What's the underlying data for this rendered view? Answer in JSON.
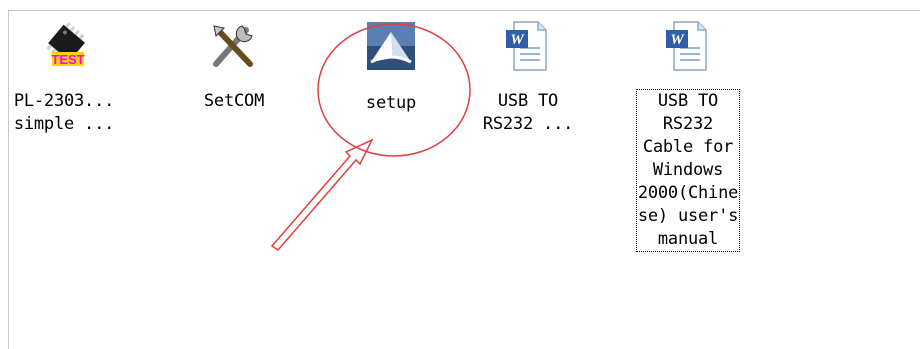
{
  "window": {
    "background": "#ffffff"
  },
  "files": [
    {
      "label": "PL-2303...\nsimple ...",
      "icon": "chip-test-icon"
    },
    {
      "label": "SetCOM",
      "icon": "tools-icon"
    },
    {
      "label": "setup",
      "icon": "installer-icon"
    },
    {
      "label": "USB TO\nRS232 ...",
      "icon": "word-document-icon"
    },
    {
      "label": "USB TO\nRS232\nCable for\nWindows\n2000(Chine\nse) user's\nmanual",
      "icon": "word-document-icon",
      "selected": true
    }
  ],
  "icon_text": {
    "chip_label": "TEST"
  },
  "annotation": {
    "color": "#e04040",
    "shapes": [
      "circle",
      "arrow"
    ]
  }
}
